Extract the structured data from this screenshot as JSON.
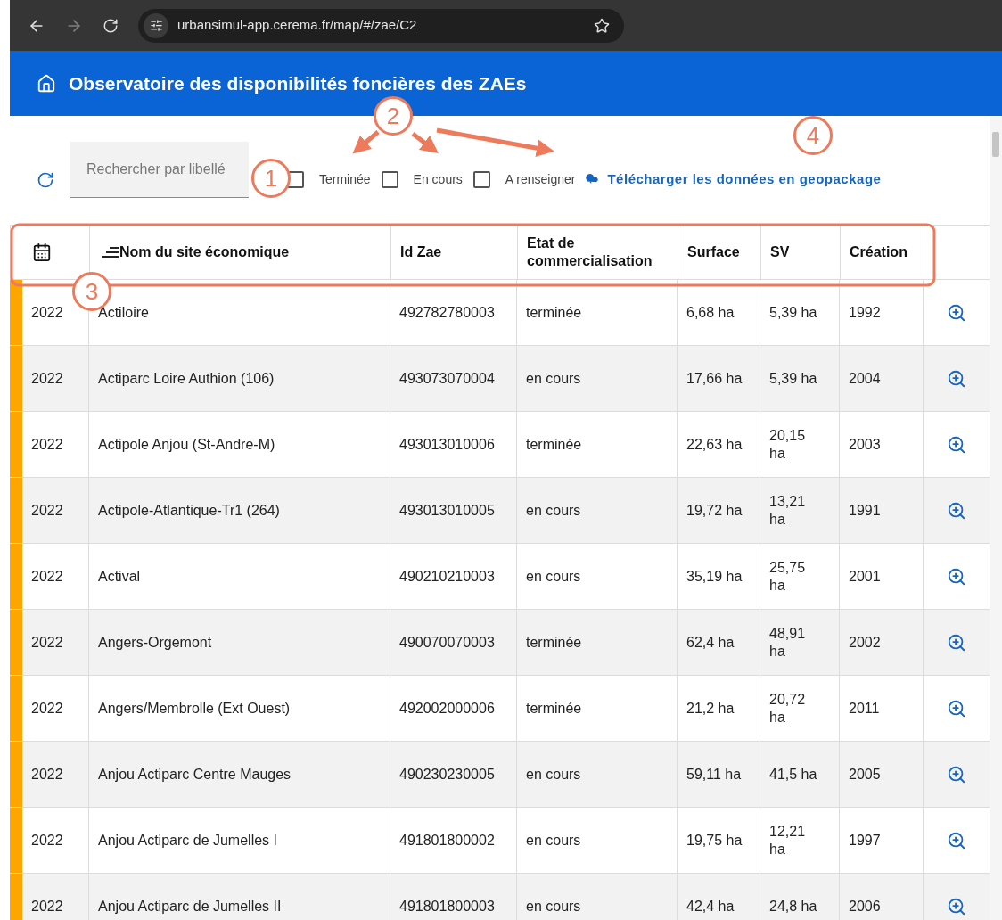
{
  "browser": {
    "url": "urbansimul-app.cerema.fr/map/#/zae/C2"
  },
  "header": {
    "title": "Observatoire des disponibilités foncières des ZAEs"
  },
  "search": {
    "placeholder": "Rechercher par libellé"
  },
  "filters": [
    {
      "label": "Terminée",
      "checked": false
    },
    {
      "label": "En cours",
      "checked": false
    },
    {
      "label": "A renseigner",
      "checked": false
    }
  ],
  "download_link": "Télécharger les données en geopackage",
  "table": {
    "columns": [
      "Nom du site économique",
      "Id Zae",
      "Etat de commercialisation",
      "Surface",
      "SV",
      "Création"
    ],
    "rows": [
      {
        "year": "2022",
        "name": "Actiloire",
        "id": "492782780003",
        "state": "terminée",
        "surface": "6,68 ha",
        "sv": "5,39 ha",
        "created": "1992"
      },
      {
        "year": "2022",
        "name": "Actiparc Loire Authion (106)",
        "id": "493073070004",
        "state": "en cours",
        "surface": "17,66 ha",
        "sv": "5,39 ha",
        "created": "2004"
      },
      {
        "year": "2022",
        "name": "Actipole Anjou (St-Andre-M)",
        "id": "493013010006",
        "state": "terminée",
        "surface": "22,63 ha",
        "sv": "20,15 ha",
        "created": "2003"
      },
      {
        "year": "2022",
        "name": "Actipole-Atlantique-Tr1 (264)",
        "id": "493013010005",
        "state": "en cours",
        "surface": "19,72 ha",
        "sv": "13,21 ha",
        "created": "1991"
      },
      {
        "year": "2022",
        "name": "Actival",
        "id": "490210210003",
        "state": "en cours",
        "surface": "35,19 ha",
        "sv": "25,75 ha",
        "created": "2001"
      },
      {
        "year": "2022",
        "name": "Angers-Orgemont",
        "id": "490070070003",
        "state": "terminée",
        "surface": "62,4 ha",
        "sv": "48,91 ha",
        "created": "2002"
      },
      {
        "year": "2022",
        "name": "Angers/Membrolle (Ext Ouest)",
        "id": "492002000006",
        "state": "terminée",
        "surface": "21,2 ha",
        "sv": "20,72 ha",
        "created": "2011"
      },
      {
        "year": "2022",
        "name": "Anjou Actiparc Centre Mauges",
        "id": "490230230005",
        "state": "en cours",
        "surface": "59,11 ha",
        "sv": "41,5 ha",
        "created": "2005"
      },
      {
        "year": "2022",
        "name": "Anjou Actiparc de Jumelles I",
        "id": "491801800002",
        "state": "en cours",
        "surface": "19,75 ha",
        "sv": "12,21 ha",
        "created": "1997"
      },
      {
        "year": "2022",
        "name": "Anjou Actiparc de Jumelles II",
        "id": "491801800003",
        "state": "en cours",
        "surface": "42,4 ha",
        "sv": "24,8 ha",
        "created": "2006"
      }
    ]
  },
  "annotations": [
    {
      "number": "1"
    },
    {
      "number": "2"
    },
    {
      "number": "3"
    },
    {
      "number": "4"
    }
  ]
}
